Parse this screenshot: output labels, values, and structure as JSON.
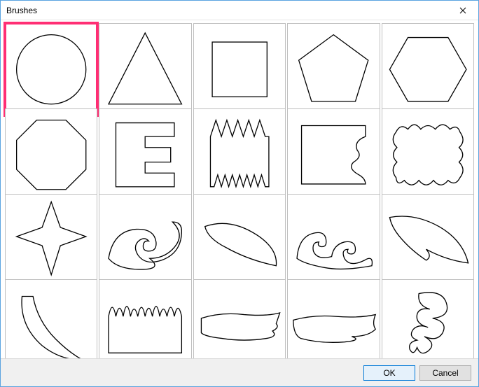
{
  "window": {
    "title": "Brushes"
  },
  "buttons": {
    "ok": "OK",
    "cancel": "Cancel"
  },
  "selected": 0,
  "brushes": [
    {
      "id": "HATCH-BRUSH-101",
      "shape": "circle"
    },
    {
      "id": "HATCH-BRUSH-102",
      "shape": "triangle"
    },
    {
      "id": "HATCH-BRUSH-103",
      "shape": "square"
    },
    {
      "id": "HATCH-BRUSH-104",
      "shape": "pentagon"
    },
    {
      "id": "HATCH-BRUSH-105",
      "shape": "hexagon"
    },
    {
      "id": "HATCH-BRUSH-106",
      "shape": "octagon"
    },
    {
      "id": "HATCH-BRUSH-201",
      "shape": "e-notch"
    },
    {
      "id": "HATCH-BRUSH-202",
      "shape": "zigzag-rect"
    },
    {
      "id": "HATCH-BRUSH-203",
      "shape": "bite-rect"
    },
    {
      "id": "HATCH-BRUSH-204",
      "shape": "wavy-rect"
    },
    {
      "id": "HATCH-BRUSH-301",
      "shape": "star4"
    },
    {
      "id": "HATCH-BRUSH-302",
      "shape": "swirl"
    },
    {
      "id": "HATCH-BRUSH-303",
      "shape": "teardrop"
    },
    {
      "id": "HATCH-BRUSH-304",
      "shape": "curl-shoe"
    },
    {
      "id": "HATCH-BRUSH-305",
      "shape": "blade"
    },
    {
      "id": "HATCH-BRUSH-306",
      "shape": "tusk"
    },
    {
      "id": "HATCH-BRUSH-401",
      "shape": "grass-rect"
    },
    {
      "id": "HATCH-BRUSH-501",
      "shape": "stroke1"
    },
    {
      "id": "HATCH-BRUSH-502",
      "shape": "stroke2"
    },
    {
      "id": "HATCH-BRUSH-503",
      "shape": "scribble"
    }
  ]
}
